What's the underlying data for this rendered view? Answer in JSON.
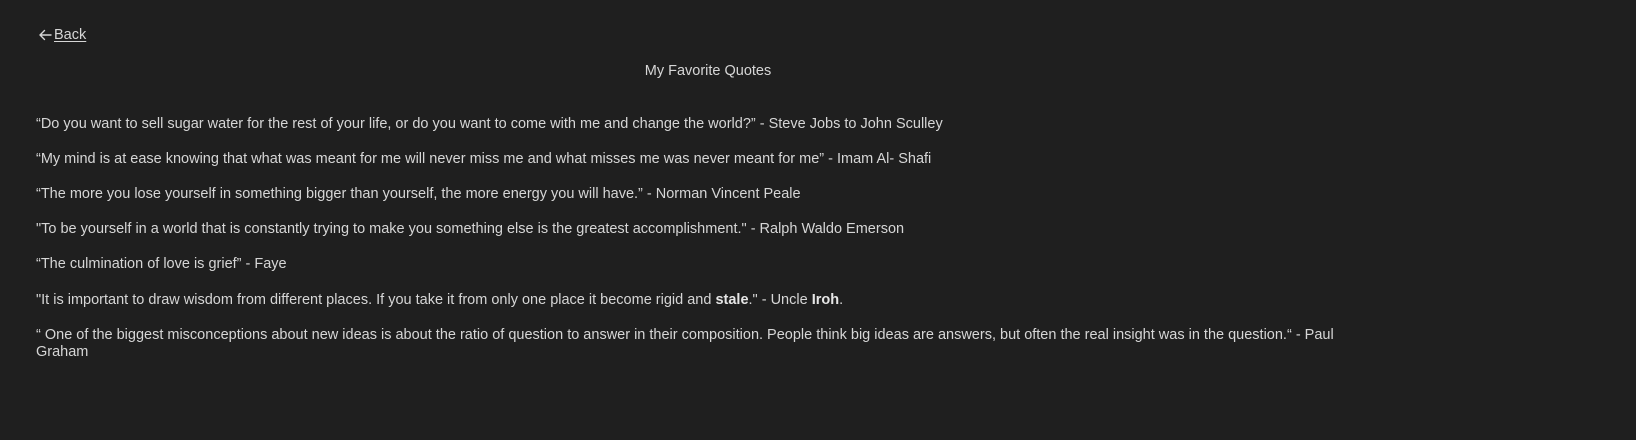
{
  "nav": {
    "back_label": "Back",
    "back_icon": "arrow-left-icon"
  },
  "page": {
    "title": "My Favorite Quotes"
  },
  "quotes": [
    {
      "text": "“Do you want to sell sugar water for the rest of your life, or do you want to come with me and change the world?” - Steve Jobs to John Sculley"
    },
    {
      "text": "“My mind is at ease knowing that what was meant for me will never miss me and what misses me was never meant for me” - Imam Al- Shafi"
    },
    {
      "text": "“The more you lose yourself in something bigger than yourself, the more energy you will have.” - Norman Vincent Peale"
    },
    {
      "text": "\"To be yourself in a world that is constantly trying to make you something else is the greatest accomplishment.\" - Ralph Waldo Emerson"
    },
    {
      "text": "“The culmination of love is grief” - Faye"
    },
    {
      "text_before": "\"It is important to draw wisdom from different places. If you take it from only one place it become rigid and ",
      "bold1": "stale",
      "text_middle": ".\" - Uncle ",
      "bold2": "Iroh",
      "text_after": "."
    },
    {
      "text": "“ One of the biggest misconceptions about new ideas is about the ratio of question to answer in their composition. People think big ideas are answers, but often the real insight was in the question.“ - Paul Graham"
    }
  ],
  "colors": {
    "background": "#1f1f1f",
    "text": "#d6d6d6"
  }
}
